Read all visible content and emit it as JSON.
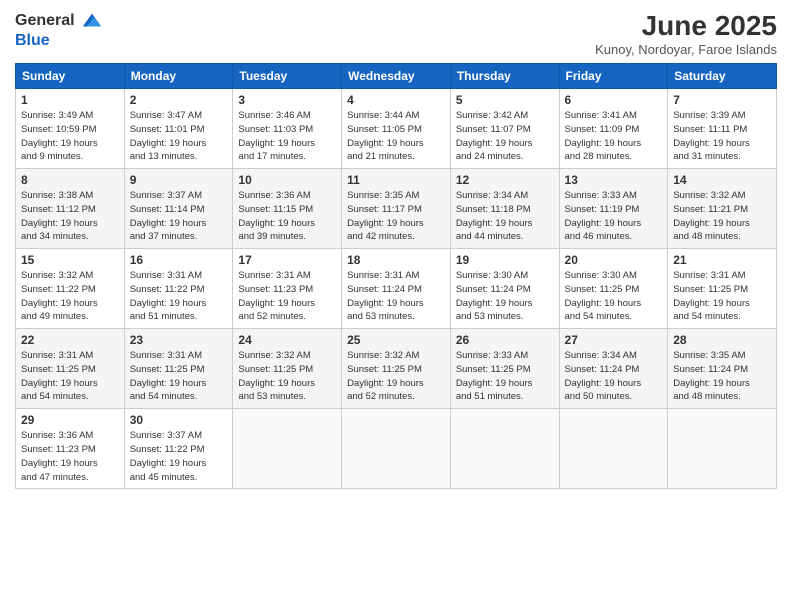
{
  "header": {
    "logo_general": "General",
    "logo_blue": "Blue",
    "title": "June 2025",
    "location": "Kunoy, Nordoyar, Faroe Islands"
  },
  "days_of_week": [
    "Sunday",
    "Monday",
    "Tuesday",
    "Wednesday",
    "Thursday",
    "Friday",
    "Saturday"
  ],
  "weeks": [
    [
      {
        "day": "1",
        "info": "Sunrise: 3:49 AM\nSunset: 10:59 PM\nDaylight: 19 hours\nand 9 minutes."
      },
      {
        "day": "2",
        "info": "Sunrise: 3:47 AM\nSunset: 11:01 PM\nDaylight: 19 hours\nand 13 minutes."
      },
      {
        "day": "3",
        "info": "Sunrise: 3:46 AM\nSunset: 11:03 PM\nDaylight: 19 hours\nand 17 minutes."
      },
      {
        "day": "4",
        "info": "Sunrise: 3:44 AM\nSunset: 11:05 PM\nDaylight: 19 hours\nand 21 minutes."
      },
      {
        "day": "5",
        "info": "Sunrise: 3:42 AM\nSunset: 11:07 PM\nDaylight: 19 hours\nand 24 minutes."
      },
      {
        "day": "6",
        "info": "Sunrise: 3:41 AM\nSunset: 11:09 PM\nDaylight: 19 hours\nand 28 minutes."
      },
      {
        "day": "7",
        "info": "Sunrise: 3:39 AM\nSunset: 11:11 PM\nDaylight: 19 hours\nand 31 minutes."
      }
    ],
    [
      {
        "day": "8",
        "info": "Sunrise: 3:38 AM\nSunset: 11:12 PM\nDaylight: 19 hours\nand 34 minutes."
      },
      {
        "day": "9",
        "info": "Sunrise: 3:37 AM\nSunset: 11:14 PM\nDaylight: 19 hours\nand 37 minutes."
      },
      {
        "day": "10",
        "info": "Sunrise: 3:36 AM\nSunset: 11:15 PM\nDaylight: 19 hours\nand 39 minutes."
      },
      {
        "day": "11",
        "info": "Sunrise: 3:35 AM\nSunset: 11:17 PM\nDaylight: 19 hours\nand 42 minutes."
      },
      {
        "day": "12",
        "info": "Sunrise: 3:34 AM\nSunset: 11:18 PM\nDaylight: 19 hours\nand 44 minutes."
      },
      {
        "day": "13",
        "info": "Sunrise: 3:33 AM\nSunset: 11:19 PM\nDaylight: 19 hours\nand 46 minutes."
      },
      {
        "day": "14",
        "info": "Sunrise: 3:32 AM\nSunset: 11:21 PM\nDaylight: 19 hours\nand 48 minutes."
      }
    ],
    [
      {
        "day": "15",
        "info": "Sunrise: 3:32 AM\nSunset: 11:22 PM\nDaylight: 19 hours\nand 49 minutes."
      },
      {
        "day": "16",
        "info": "Sunrise: 3:31 AM\nSunset: 11:22 PM\nDaylight: 19 hours\nand 51 minutes."
      },
      {
        "day": "17",
        "info": "Sunrise: 3:31 AM\nSunset: 11:23 PM\nDaylight: 19 hours\nand 52 minutes."
      },
      {
        "day": "18",
        "info": "Sunrise: 3:31 AM\nSunset: 11:24 PM\nDaylight: 19 hours\nand 53 minutes."
      },
      {
        "day": "19",
        "info": "Sunrise: 3:30 AM\nSunset: 11:24 PM\nDaylight: 19 hours\nand 53 minutes."
      },
      {
        "day": "20",
        "info": "Sunrise: 3:30 AM\nSunset: 11:25 PM\nDaylight: 19 hours\nand 54 minutes."
      },
      {
        "day": "21",
        "info": "Sunrise: 3:31 AM\nSunset: 11:25 PM\nDaylight: 19 hours\nand 54 minutes."
      }
    ],
    [
      {
        "day": "22",
        "info": "Sunrise: 3:31 AM\nSunset: 11:25 PM\nDaylight: 19 hours\nand 54 minutes."
      },
      {
        "day": "23",
        "info": "Sunrise: 3:31 AM\nSunset: 11:25 PM\nDaylight: 19 hours\nand 54 minutes."
      },
      {
        "day": "24",
        "info": "Sunrise: 3:32 AM\nSunset: 11:25 PM\nDaylight: 19 hours\nand 53 minutes."
      },
      {
        "day": "25",
        "info": "Sunrise: 3:32 AM\nSunset: 11:25 PM\nDaylight: 19 hours\nand 52 minutes."
      },
      {
        "day": "26",
        "info": "Sunrise: 3:33 AM\nSunset: 11:25 PM\nDaylight: 19 hours\nand 51 minutes."
      },
      {
        "day": "27",
        "info": "Sunrise: 3:34 AM\nSunset: 11:24 PM\nDaylight: 19 hours\nand 50 minutes."
      },
      {
        "day": "28",
        "info": "Sunrise: 3:35 AM\nSunset: 11:24 PM\nDaylight: 19 hours\nand 48 minutes."
      }
    ],
    [
      {
        "day": "29",
        "info": "Sunrise: 3:36 AM\nSunset: 11:23 PM\nDaylight: 19 hours\nand 47 minutes."
      },
      {
        "day": "30",
        "info": "Sunrise: 3:37 AM\nSunset: 11:22 PM\nDaylight: 19 hours\nand 45 minutes."
      },
      null,
      null,
      null,
      null,
      null
    ]
  ]
}
